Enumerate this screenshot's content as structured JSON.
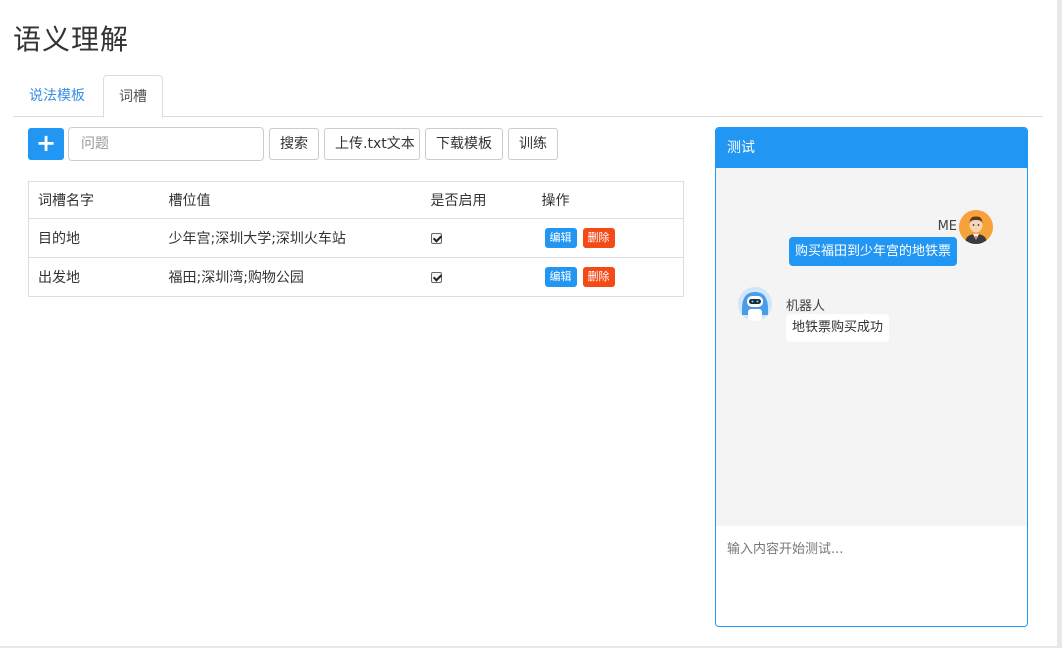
{
  "page": {
    "title": "语义理解"
  },
  "tabs": [
    {
      "label": "说法模板",
      "active": false
    },
    {
      "label": "词槽",
      "active": true
    }
  ],
  "toolbar": {
    "add_icon": "+",
    "search_placeholder": "问题",
    "search_label": "搜索",
    "upload_label": "上传.txt文本",
    "download_label": "下载模板",
    "train_label": "训练"
  },
  "table": {
    "headers": [
      "词槽名字",
      "槽位值",
      "是否启用",
      "操作"
    ],
    "rows": [
      {
        "name": "目的地",
        "values": "少年宫;深圳大学;深圳火车站",
        "enabled": true,
        "edit": "编辑",
        "delete": "删除"
      },
      {
        "name": "出发地",
        "values": "福田;深圳湾;购物公园",
        "enabled": true,
        "edit": "编辑",
        "delete": "删除"
      }
    ]
  },
  "test_panel": {
    "title": "测试",
    "messages": [
      {
        "sender": "ME",
        "text": "购买福田到少年宫的地铁票",
        "avatar_icon": "user-avatar-icon"
      },
      {
        "sender": "机器人",
        "text": "地铁票购买成功",
        "avatar_icon": "robot-avatar-icon"
      }
    ],
    "input_placeholder": "输入内容开始测试..."
  },
  "colors": {
    "accent": "#2196f3",
    "danger": "#f44a18",
    "chat_bg": "#f4f4f4",
    "link": "#3a8ee6"
  }
}
